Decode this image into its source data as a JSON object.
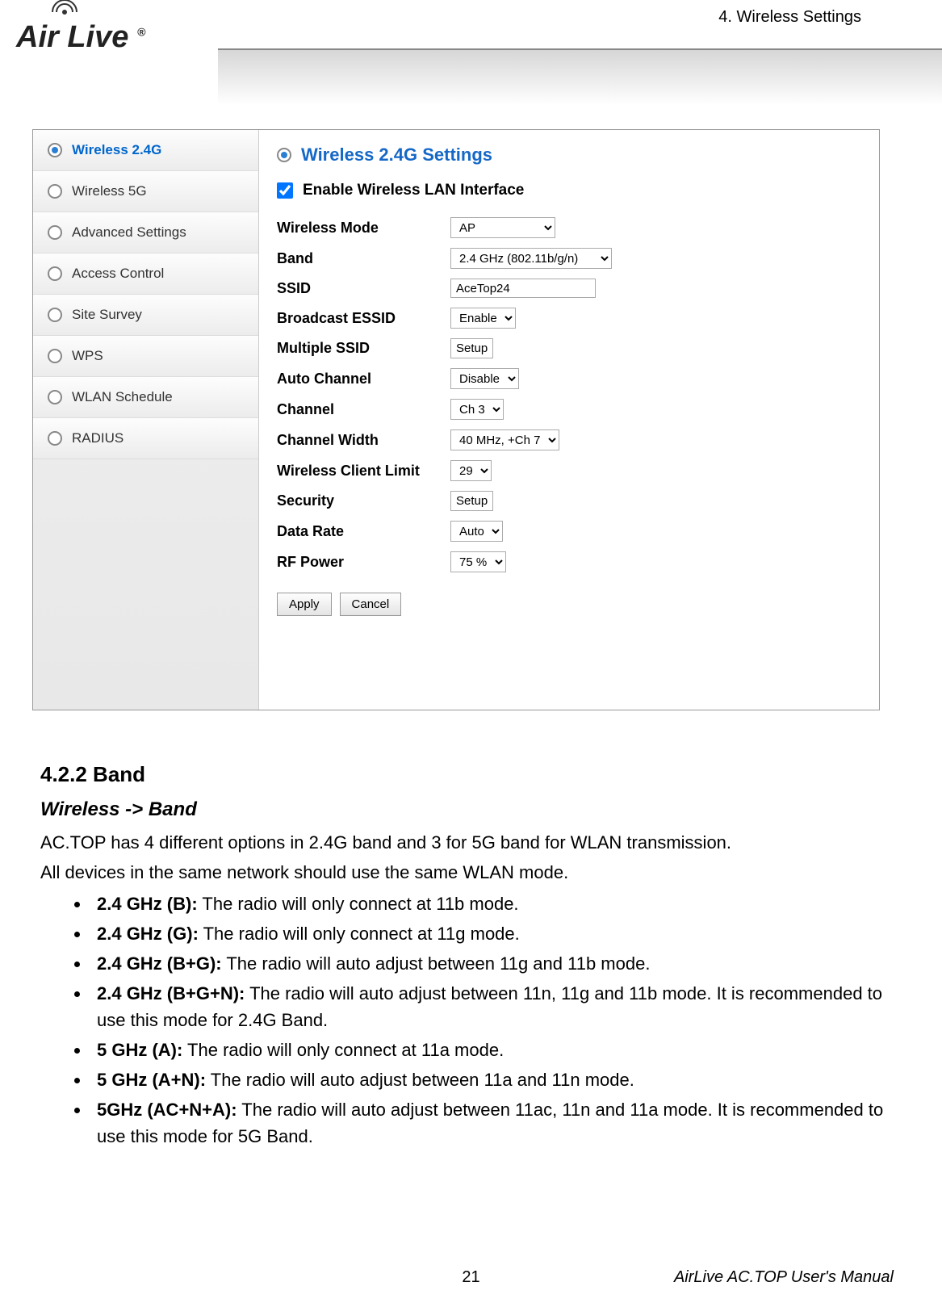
{
  "header": {
    "chapter": "4. Wireless Settings",
    "logo_text": "Air Live"
  },
  "sidebar": {
    "items": [
      {
        "label": "Wireless 2.4G",
        "active": true
      },
      {
        "label": "Wireless 5G",
        "active": false
      },
      {
        "label": "Advanced Settings",
        "active": false
      },
      {
        "label": "Access Control",
        "active": false
      },
      {
        "label": "Site Survey",
        "active": false
      },
      {
        "label": "WPS",
        "active": false
      },
      {
        "label": "WLAN Schedule",
        "active": false
      },
      {
        "label": "RADIUS",
        "active": false
      }
    ]
  },
  "panel": {
    "title": "Wireless 2.4G Settings",
    "enable_label": "Enable Wireless LAN Interface",
    "enable_checked": true,
    "fields": {
      "wireless_mode": {
        "label": "Wireless Mode",
        "value": "AP"
      },
      "band": {
        "label": "Band",
        "value": "2.4 GHz (802.11b/g/n)"
      },
      "ssid": {
        "label": "SSID",
        "value": "AceTop24"
      },
      "broadcast_essid": {
        "label": "Broadcast ESSID",
        "value": "Enable"
      },
      "multiple_ssid": {
        "label": "Multiple SSID",
        "button": "Setup"
      },
      "auto_channel": {
        "label": "Auto Channel",
        "value": "Disable"
      },
      "channel": {
        "label": "Channel",
        "value": "Ch 3"
      },
      "channel_width": {
        "label": "Channel Width",
        "value": "40 MHz, +Ch 7"
      },
      "client_limit": {
        "label": "Wireless Client Limit",
        "value": "29"
      },
      "security": {
        "label": "Security",
        "button": "Setup"
      },
      "data_rate": {
        "label": "Data Rate",
        "value": "Auto"
      },
      "rf_power": {
        "label": "RF Power",
        "value": "75 %"
      }
    },
    "actions": {
      "apply": "Apply",
      "cancel": "Cancel"
    }
  },
  "doc": {
    "heading": "4.2.2 Band",
    "sub": "Wireless -> Band",
    "intro1": "AC.TOP has 4 different options in 2.4G band and 3 for 5G band for WLAN transmission.",
    "intro2": "All devices in the same network should use the same WLAN mode.",
    "bullets": [
      {
        "bold": "2.4 GHz (B):",
        "text": "   The radio will only connect at 11b mode."
      },
      {
        "bold": "2.4 GHz (G):",
        "text": "   The radio will only connect at 11g mode."
      },
      {
        "bold": "2.4 GHz (B+G):",
        "text": " The radio will auto adjust between 11g and 11b mode."
      },
      {
        "bold": "2.4 GHz (B+G+N):",
        "text": " The radio will auto adjust between 11n, 11g and 11b mode. It is recommended to use this mode for 2.4G Band."
      },
      {
        "bold": "5 GHz (A):",
        "text": "   The radio will only connect at 11a mode."
      },
      {
        "bold": "5 GHz (A+N):",
        "text": " The radio will auto adjust between 11a and 11n mode."
      },
      {
        "bold": "5GHz (AC+N+A):",
        "text": " The radio will auto adjust between 11ac, 11n and 11a mode. It is recommended to use this mode for 5G Band."
      }
    ]
  },
  "footer": {
    "page": "21",
    "right": "AirLive AC.TOP User's Manual"
  }
}
